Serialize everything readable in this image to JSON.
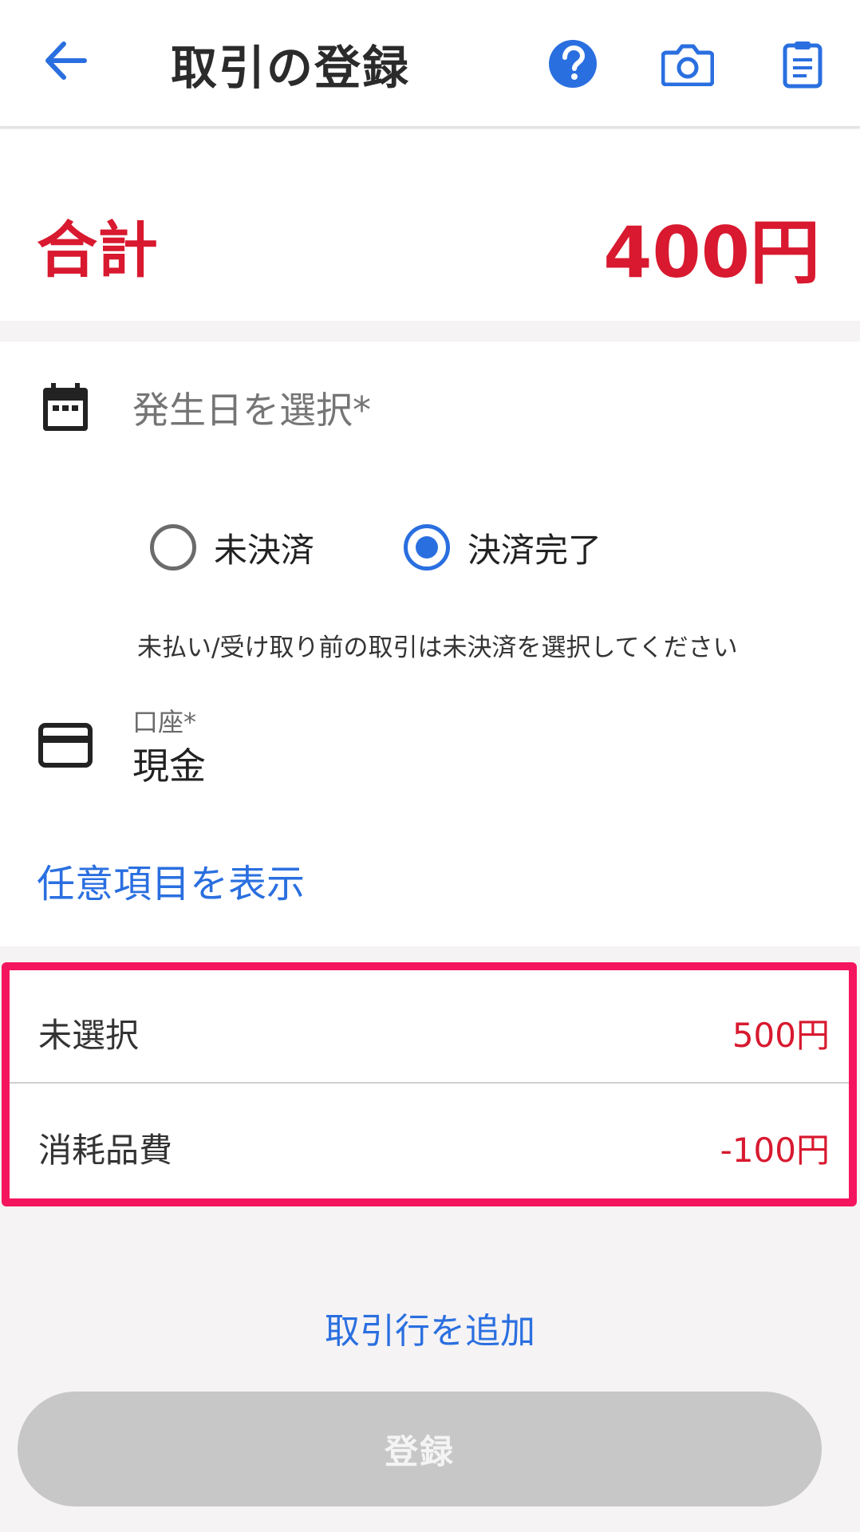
{
  "header": {
    "title": "取引の登録",
    "icons": [
      "arrow-back-icon",
      "help-icon",
      "camera-icon",
      "clipboard-icon"
    ]
  },
  "total": {
    "label": "合計",
    "value": "400円"
  },
  "form": {
    "date_placeholder": "発生日を選択*",
    "payment_status": {
      "options": [
        "未決済",
        "決済完了"
      ],
      "selected": "決済完了"
    },
    "hint": "未払い/受け取り前の取引は未決済を選択してください",
    "account": {
      "label": "口座*",
      "value": "現金"
    },
    "optional_link": "任意項目を表示"
  },
  "lines": [
    {
      "name": "未選択",
      "amount": "500円"
    },
    {
      "name": "消耗品費",
      "amount": "-100円"
    }
  ],
  "add_line_label": "取引行を追加",
  "submit_label": "登録",
  "colors": {
    "accent_blue": "#2a6fe0",
    "amount_red": "#d8192f",
    "highlight_border": "#f5155e",
    "disabled_button": "#c8c7c8"
  }
}
